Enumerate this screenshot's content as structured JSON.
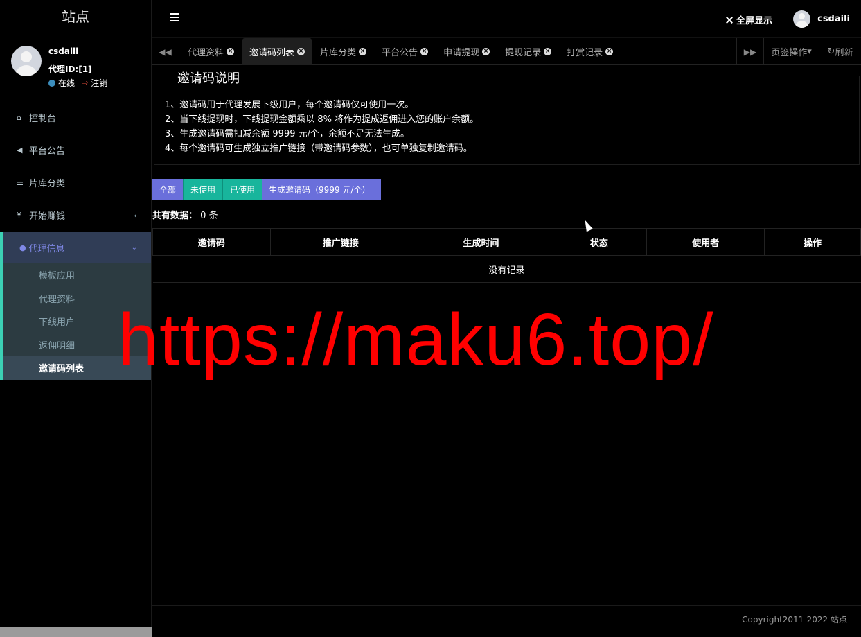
{
  "sidebar": {
    "logo": "站点",
    "user": {
      "name": "csdaili",
      "id_label": "代理ID:[1]",
      "status": "在线",
      "logout": "注销"
    },
    "menu": [
      {
        "label": "控制台",
        "icon": "home-icon"
      },
      {
        "label": "平台公告",
        "icon": "bullhorn-icon"
      },
      {
        "label": "片库分类",
        "icon": "list-icon"
      },
      {
        "label": "开始赚钱",
        "icon": "yen-icon"
      }
    ],
    "group": {
      "label": "代理信息",
      "icon": "user-icon",
      "items": [
        "模板应用",
        "代理资料",
        "下线用户",
        "返佣明细",
        "邀请码列表"
      ],
      "active": "邀请码列表"
    }
  },
  "header": {
    "fullscreen": "全屏显示",
    "username": "csdaili"
  },
  "tabbar": {
    "tabs": [
      {
        "label": "代理资料",
        "active": false
      },
      {
        "label": "邀请码列表",
        "active": true
      },
      {
        "label": "片库分类",
        "active": false
      },
      {
        "label": "平台公告",
        "active": false
      },
      {
        "label": "申请提现",
        "active": false
      },
      {
        "label": "提现记录",
        "active": false
      },
      {
        "label": "打赏记录",
        "active": false
      }
    ],
    "ops": "页签操作",
    "refresh": "刷新"
  },
  "notice": {
    "title": "邀请码说明",
    "lines": [
      "1、邀请码用于代理发展下级用户，每个邀请码仅可使用一次。",
      "2、当下线提现时，下线提现金额乘以 8% 将作为提成返佣进入您的账户余额。",
      "3、生成邀请码需扣减余额 9999 元/个，余额不足无法生成。",
      "4、每个邀请码可生成独立推广链接（带邀请码参数），也可单独复制邀请码。"
    ]
  },
  "filters": {
    "all": "全部",
    "unused": "未使用",
    "used": "已使用",
    "generate": "生成邀请码（9999 元/个）"
  },
  "count": {
    "label": "共有数据：",
    "value": "0",
    "unit": "条"
  },
  "table": {
    "columns": [
      "邀请码",
      "推广链接",
      "生成时间",
      "状态",
      "使用者",
      "操作"
    ],
    "empty": "没有记录"
  },
  "watermark": "https://maku6.top/",
  "footer": "Copyright2011-2022 站点",
  "colors": {
    "accent_purple": "#6a6fdb",
    "accent_teal": "#18b59c",
    "watermark": "#ff0000"
  }
}
